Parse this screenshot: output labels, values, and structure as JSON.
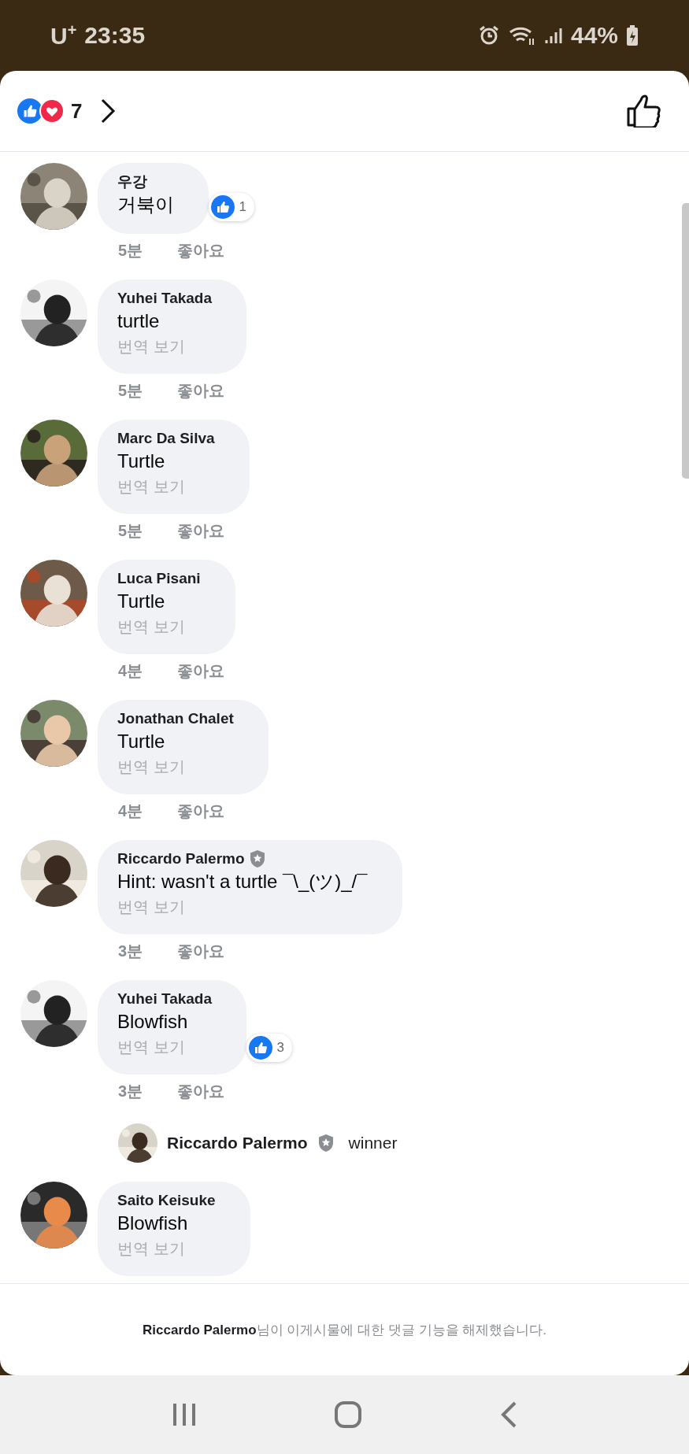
{
  "status_bar": {
    "carrier": "U$^{+}$",
    "time": "23:35",
    "battery": "44%"
  },
  "header": {
    "reaction_count": "7"
  },
  "comments": [
    {
      "author": "우강",
      "text": "거북이",
      "time": "5분",
      "like_label": "좋아요",
      "verified": false,
      "reaction_count": "1"
    },
    {
      "author": "Yuhei Takada",
      "text": "turtle",
      "translate": "번역 보기",
      "time": "5분",
      "like_label": "좋아요",
      "verified": false
    },
    {
      "author": "Marc Da Silva",
      "text": "Turtle",
      "translate": "번역 보기",
      "time": "5분",
      "like_label": "좋아요",
      "verified": false
    },
    {
      "author": "Luca Pisani",
      "text": "Turtle",
      "translate": "번역 보기",
      "time": "4분",
      "like_label": "좋아요",
      "verified": false
    },
    {
      "author": "Jonathan Chalet",
      "text": "Turtle",
      "translate": "번역 보기",
      "time": "4분",
      "like_label": "좋아요",
      "verified": false
    },
    {
      "author": "Riccardo Palermo",
      "text": "Hint: wasn't a turtle ¯\\_(ツ)_/¯",
      "translate": "번역 보기",
      "time": "3분",
      "like_label": "좋아요",
      "verified": true
    },
    {
      "author": "Yuhei Takada",
      "text": "Blowfish",
      "translate": "번역 보기",
      "time": "3분",
      "like_label": "좋아요",
      "verified": false,
      "reaction_count": "3",
      "replies": [
        {
          "author": "Riccardo Palermo",
          "verified": true,
          "text": "winner"
        }
      ]
    },
    {
      "author": "Saito Keisuke",
      "text": "Blowfish",
      "translate": "번역 보기",
      "verified": false
    }
  ],
  "footer": {
    "author": "Riccardo Palermo",
    "message": "님이 이게시물에 대한 댓글 기능을 해제했습니다."
  }
}
